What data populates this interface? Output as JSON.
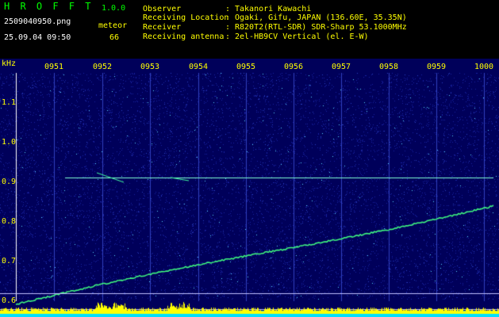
{
  "header": {
    "app_name": "H R O F F T",
    "version": "1.0.0",
    "filename": "2509040950.png",
    "datetime": "25.09.04 09:50",
    "meteor_label": "meteor",
    "meteor_count": "66"
  },
  "metadata": [
    {
      "label": "Observer",
      "value": "Takanori Kawachi"
    },
    {
      "label": "Receiving Location",
      "value": "Ogaki, Gifu, JAPAN (136.60E, 35.35N)"
    },
    {
      "label": "Receiver",
      "value": "R820T2(RTL-SDR) SDR-Sharp 53.1000MHz"
    },
    {
      "label": "Receiving antenna",
      "value": "2el-HB9CV Vertical (el. E-W)"
    }
  ],
  "spectrogram": {
    "unit": "kHz",
    "time_ticks": [
      "0951",
      "0952",
      "0953",
      "0954",
      "0955",
      "0956",
      "0957",
      "0958",
      "0959",
      "1000"
    ],
    "freq_ticks": [
      "1.1",
      "1.0",
      "0.9",
      "0.8",
      "0.7",
      "0.6"
    ],
    "colors": {
      "background": "#00005a",
      "trace": "#7fffd4",
      "meter": "#ffff00",
      "meter_base": "#00e0ff"
    }
  }
}
